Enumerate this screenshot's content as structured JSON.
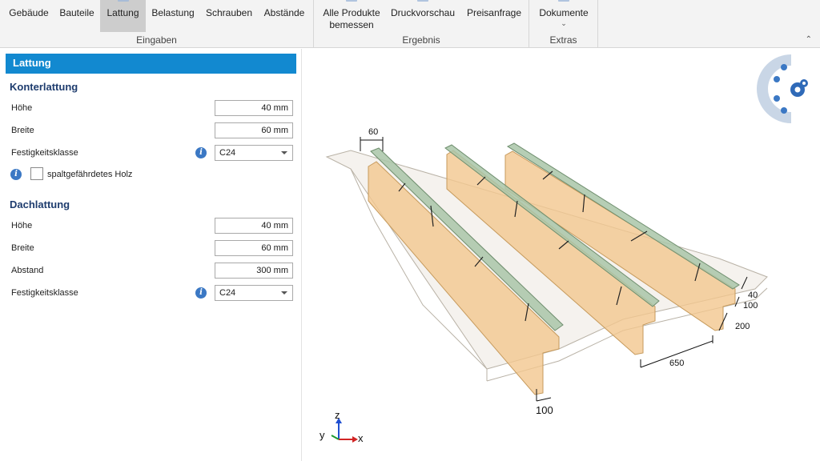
{
  "ribbon": {
    "groups": [
      {
        "label": "Eingaben",
        "items": [
          "Gebäude",
          "Bauteile",
          "Lattung",
          "Belastung",
          "Schrauben",
          "Abstände"
        ]
      },
      {
        "label": "Ergebnis",
        "items": [
          "Alle Produkte\nbemessen",
          "Druckvorschau",
          "Preisanfrage"
        ]
      },
      {
        "label": "Extras",
        "items": [
          "Dokumente"
        ]
      }
    ],
    "active_item": "Lattung"
  },
  "panel": {
    "title": "Lattung",
    "konterlattung": {
      "heading": "Konterlattung",
      "hoehe_label": "Höhe",
      "hoehe_value": "40 mm",
      "breite_label": "Breite",
      "breite_value": "60 mm",
      "festigkeit_label": "Festigkeitsklasse",
      "festigkeit_value": "C24",
      "spalt_label": "spaltgefährdetes Holz",
      "spalt_checked": false
    },
    "dachlattung": {
      "heading": "Dachlattung",
      "hoehe_label": "Höhe",
      "hoehe_value": "40 mm",
      "breite_label": "Breite",
      "breite_value": "60 mm",
      "abstand_label": "Abstand",
      "abstand_value": "300 mm",
      "festigkeit_label": "Festigkeitsklasse",
      "festigkeit_value": "C24"
    }
  },
  "viewport": {
    "dimensions": {
      "lath_width": "60",
      "lath_height": "40",
      "board_thickness": "100",
      "rafter_height": "200",
      "rafter_spacing": "650",
      "rafter_width": "100"
    },
    "axes": {
      "x": "x",
      "y": "y",
      "z": "z"
    }
  },
  "colors": {
    "accent": "#1289d0",
    "heading": "#1e3c6e",
    "rafter": "#f2c78e",
    "lath": "#a9c6a8",
    "board": "#ede8e0"
  }
}
